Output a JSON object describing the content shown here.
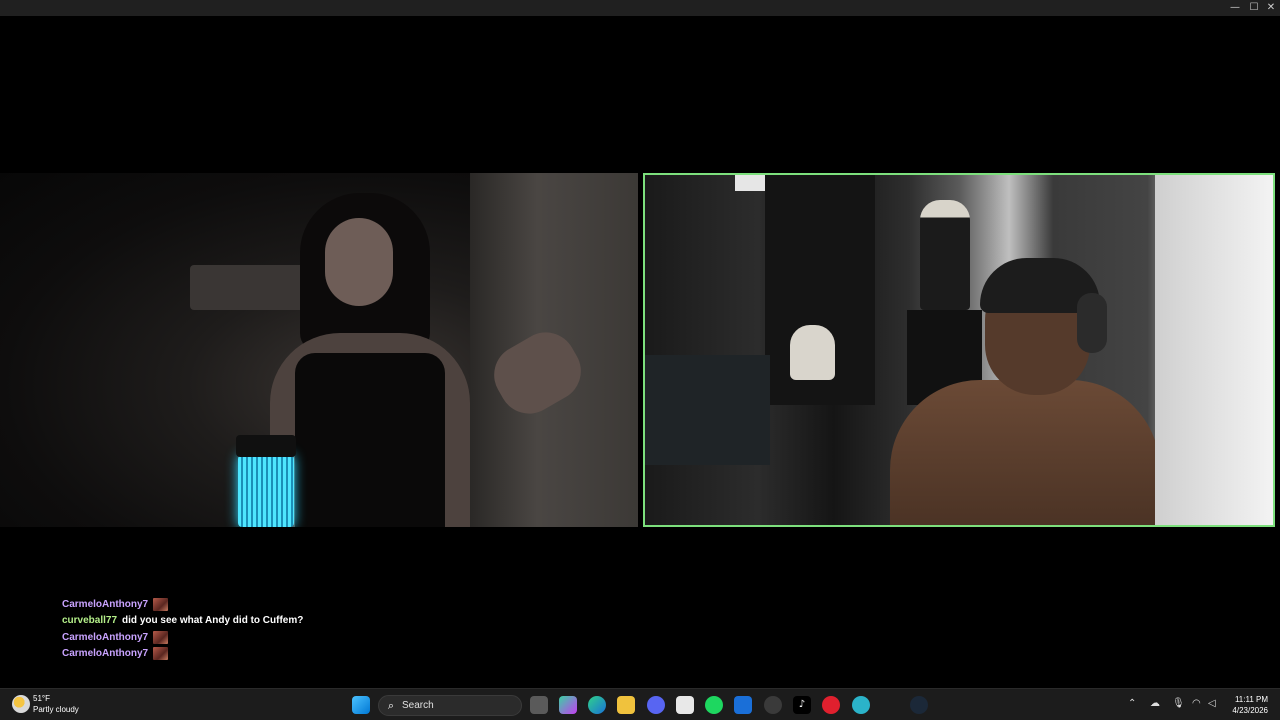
{
  "window": {
    "minimize_glyph": "—",
    "maximize_glyph": "☐",
    "close_glyph": "✕"
  },
  "chat": {
    "messages": [
      {
        "user": "CarmeloAnthony7",
        "user_color": "#c9a3ff",
        "text": "",
        "emote": true
      },
      {
        "user": "curveball77",
        "user_color": "#b5f08a",
        "text": "did you see what Andy did to Cuffem?",
        "emote": false
      },
      {
        "user": "CarmeloAnthony7",
        "user_color": "#c9a3ff",
        "text": "",
        "emote": true
      },
      {
        "user": "CarmeloAnthony7",
        "user_color": "#c9a3ff",
        "text": "",
        "emote": true
      }
    ]
  },
  "taskbar": {
    "weather": {
      "temp": "51°F",
      "condition": "Partly cloudy",
      "icon": "partly-cloudy-icon"
    },
    "search_label": "Search",
    "apps": [
      "start",
      "search",
      "task-view",
      "copilot",
      "edge",
      "file-explorer",
      "discord",
      "microsoft-store",
      "spotify",
      "mail",
      "obs",
      "tiktok",
      "opera",
      "browser",
      "steam"
    ],
    "clock": {
      "time": "11:11 PM",
      "date": "4/23/2026"
    }
  },
  "colors": {
    "active_border": "#7de07d",
    "taskbar": "#1c1c1c"
  }
}
